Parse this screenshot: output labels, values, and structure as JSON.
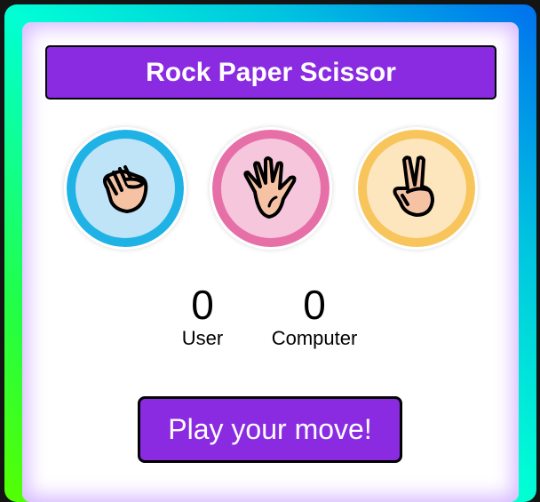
{
  "header": {
    "title": "Rock Paper Scissor"
  },
  "choices": [
    {
      "id": "rock",
      "icon": "fist-icon",
      "ring": "#1fb2e5",
      "fill": "#bfe3f7"
    },
    {
      "id": "paper",
      "icon": "open-hand-icon",
      "ring": "#e76fa8",
      "fill": "#f6c7dc"
    },
    {
      "id": "scissors",
      "icon": "peace-hand-icon",
      "ring": "#f7c55c",
      "fill": "#fde6be"
    }
  ],
  "scoreboard": {
    "user_score": "0",
    "user_label": "User",
    "computer_score": "0",
    "computer_label": "Computer"
  },
  "message": {
    "text": "Play your move!"
  },
  "colors": {
    "accent": "#8a2be2",
    "skin": "#f5c3a3"
  }
}
